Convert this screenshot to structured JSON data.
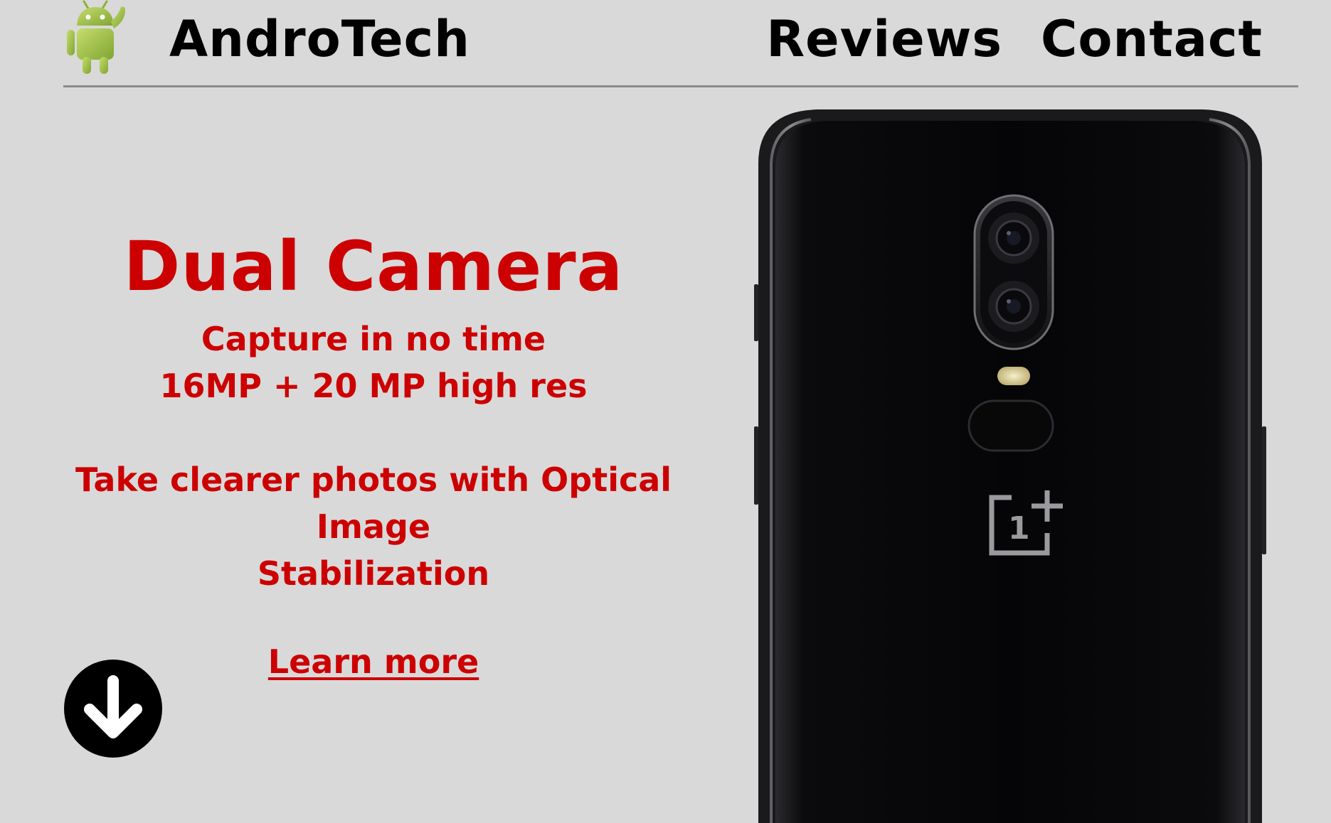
{
  "header": {
    "brand": "AndroTech",
    "nav": [
      {
        "label": "Reviews"
      },
      {
        "label": "Contact"
      }
    ]
  },
  "hero": {
    "title": "Dual Camera",
    "subtitle_line1": "Capture in no time",
    "subtitle_line2": "16MP + 20 MP high res",
    "description_line1": "Take clearer photos with Optical Image",
    "description_line2": "Stabilization",
    "link_label": "Learn more"
  },
  "icons": {
    "logo": "android-mascot-icon",
    "scroll": "arrow-down-circle-icon"
  },
  "colors": {
    "background": "#d9d9d9",
    "accent": "#cc0000",
    "text": "#000000"
  }
}
